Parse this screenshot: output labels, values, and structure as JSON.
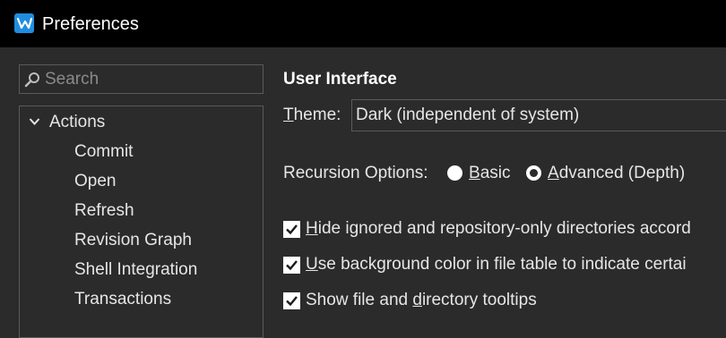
{
  "window": {
    "title": "Preferences"
  },
  "search": {
    "placeholder": "Search",
    "value": ""
  },
  "tree": {
    "group_label": "Actions",
    "items": [
      "Commit",
      "Open",
      "Refresh",
      "Revision Graph",
      "Shell Integration",
      "Transactions"
    ]
  },
  "section": {
    "title": "User Interface"
  },
  "theme": {
    "label_key": "T",
    "label_rest": "heme:",
    "value": "Dark (independent of system)"
  },
  "recursion": {
    "label": "Recursion Options:",
    "options": [
      {
        "key": "B",
        "rest": "asic",
        "selected": false
      },
      {
        "key": "A",
        "rest": "dvanced (Depth)",
        "selected": true
      }
    ]
  },
  "checkboxes": [
    {
      "pre": "",
      "key": "H",
      "post": "ide ignored and repository-only directories accord",
      "checked": true
    },
    {
      "pre": "",
      "key": "U",
      "post": "se background color in file table to indicate certai",
      "checked": true
    },
    {
      "pre": "Show file and ",
      "key": "d",
      "post": "irectory tooltips",
      "checked": true
    }
  ],
  "colors": {
    "accent": "#1f8ee0",
    "background": "#2b2b2b",
    "titlebar": "#000000"
  }
}
